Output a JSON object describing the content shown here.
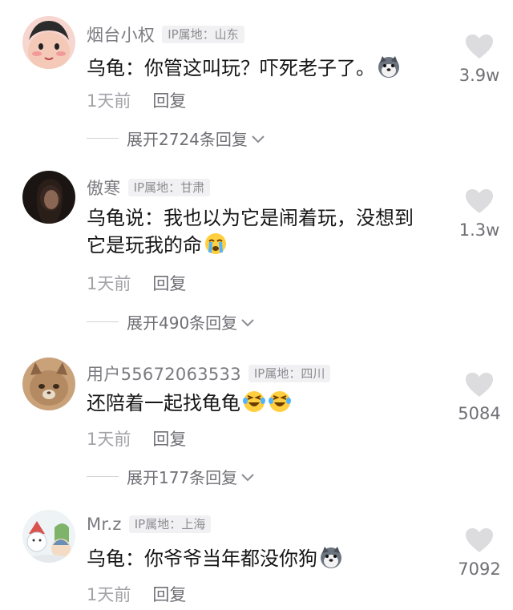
{
  "comments": [
    {
      "username": "烟台小权",
      "ip": "IP属地：山东",
      "text": "乌龟：你管这叫玩？吓死老子了。",
      "emoji_icons": [
        "husky-dog-emoji-icon"
      ],
      "time": "1天前",
      "reply_label": "回复",
      "expand_label": "展开2724条回复",
      "likes": "3.9w"
    },
    {
      "username": "傲寒",
      "ip": "IP属地：甘肃",
      "text_line1": "乌龟说：我也以为它是闹着玩，没想到",
      "text_line2": "它是玩我的命",
      "emoji_icons": [
        "crying-face-emoji-icon"
      ],
      "time": "1天前",
      "reply_label": "回复",
      "expand_label": "展开490条回复",
      "likes": "1.3w"
    },
    {
      "username": "用户55672063533",
      "ip": "IP属地：四川",
      "text": "还陪着一起找龟龟",
      "emoji_icons": [
        "laughing-tears-emoji-icon",
        "laughing-tears-emoji-icon"
      ],
      "time": "1天前",
      "reply_label": "回复",
      "expand_label": "展开177条回复",
      "likes": "5084"
    },
    {
      "username": "Mr.z",
      "ip": "IP属地：上海",
      "text": "乌龟：你爷爷当年都没你狗",
      "emoji_icons": [
        "husky-dog-emoji-icon"
      ],
      "time": "1天前",
      "reply_label": "回复",
      "likes": "7092"
    }
  ],
  "colors": {
    "username": "#7b7b80",
    "text": "#161616",
    "secondary": "#a2a2a8",
    "heart": "#dcdcdf"
  }
}
